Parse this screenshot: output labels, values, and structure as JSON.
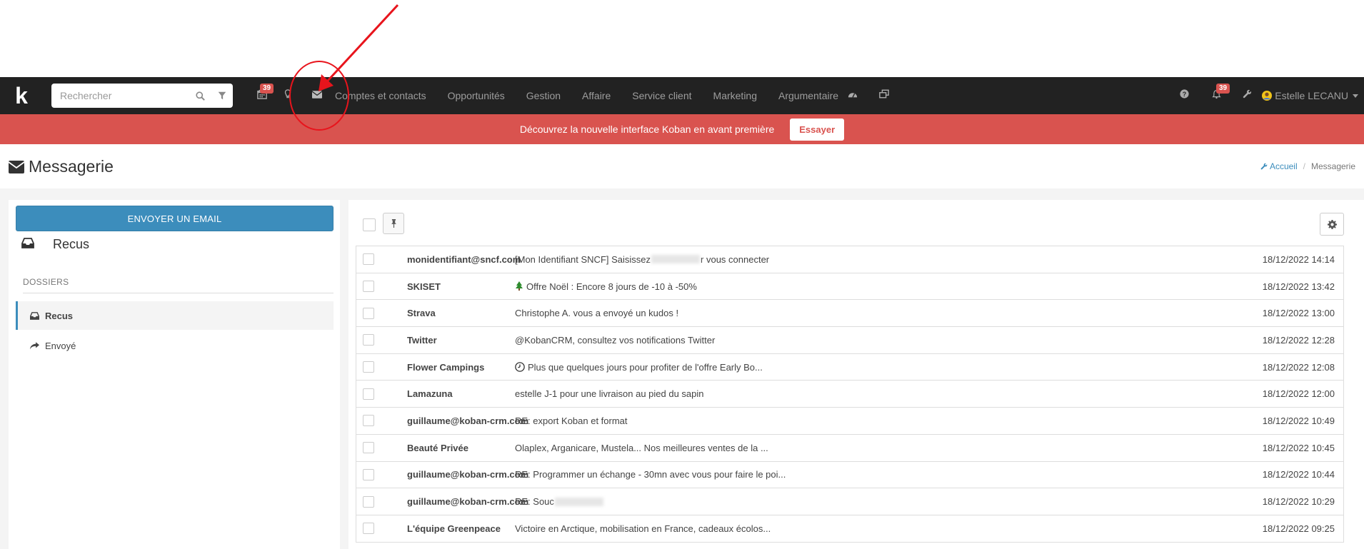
{
  "navbar": {
    "logo": "k",
    "search_placeholder": "Rechercher",
    "calendar_badge": "39",
    "menu": [
      "Comptes et contacts",
      "Opportunités",
      "Gestion",
      "Affaire",
      "Service client",
      "Marketing",
      "Argumentaire"
    ],
    "notifications_badge": "39",
    "user_name": "Estelle LECANU"
  },
  "banner": {
    "text": "Découvrez la nouvelle interface Koban en avant première",
    "button": "Essayer"
  },
  "page": {
    "title": "Messagerie",
    "breadcrumb_home": "Accueil",
    "breadcrumb_current": "Messagerie"
  },
  "sidebar": {
    "send_button": "ENVOYER UN EMAIL",
    "inbox_title": "Recus",
    "folders_label": "DOSSIERS",
    "folders": [
      {
        "label": "Recus",
        "active": true,
        "icon": "inbox-icon"
      },
      {
        "label": "Envoyé",
        "active": false,
        "icon": "reply-icon"
      }
    ]
  },
  "mails": [
    {
      "from": "monidentifiant@sncf.com",
      "subject_pre": "[Mon Identifiant SNCF] Saisissez",
      "blurred": true,
      "subject_post": "r vous connecter",
      "date": "18/12/2022 14:14"
    },
    {
      "from": "SKISET",
      "icon": "tree",
      "subject_pre": "Offre Noël : Encore 8 jours de -10 à -50%",
      "date": "18/12/2022 13:42"
    },
    {
      "from": "Strava",
      "subject_pre": "Christophe A. vous a envoyé un kudos !",
      "date": "18/12/2022 13:00"
    },
    {
      "from": "Twitter",
      "subject_pre": "@KobanCRM, consultez vos notifications Twitter",
      "date": "18/12/2022 12:28"
    },
    {
      "from": "Flower Campings",
      "icon": "clock",
      "subject_pre": "Plus que quelques jours pour profiter de l'offre Early Bo...",
      "date": "18/12/2022 12:08"
    },
    {
      "from": "Lamazuna",
      "subject_pre": "estelle J-1 pour une livraison au pied du sapin",
      "date": "18/12/2022 12:00"
    },
    {
      "from": "guillaume@koban-crm.com",
      "subject_pre": "RE: export Koban et format",
      "date": "18/12/2022 10:49"
    },
    {
      "from": "Beauté Privée",
      "subject_pre": "Olaplex, Arganicare, Mustela... Nos meilleures ventes de la ...",
      "date": "18/12/2022 10:45"
    },
    {
      "from": "guillaume@koban-crm.com",
      "subject_pre": "RE: Programmer un échange - 30mn avec vous pour faire le poi...",
      "date": "18/12/2022 10:44"
    },
    {
      "from": "guillaume@koban-crm.com",
      "subject_pre": "RE: Souc",
      "blurred": true,
      "subject_post": "",
      "date": "18/12/2022 10:29"
    },
    {
      "from": "L'équipe Greenpeace",
      "subject_pre": "Victoire en Arctique, mobilisation en France, cadeaux écolos...",
      "date": "18/12/2022 09:25"
    }
  ],
  "colors": {
    "navbar": "#222222",
    "banner": "#d9534f",
    "primary": "#3c8dbc",
    "annotation": "#e8141c"
  }
}
